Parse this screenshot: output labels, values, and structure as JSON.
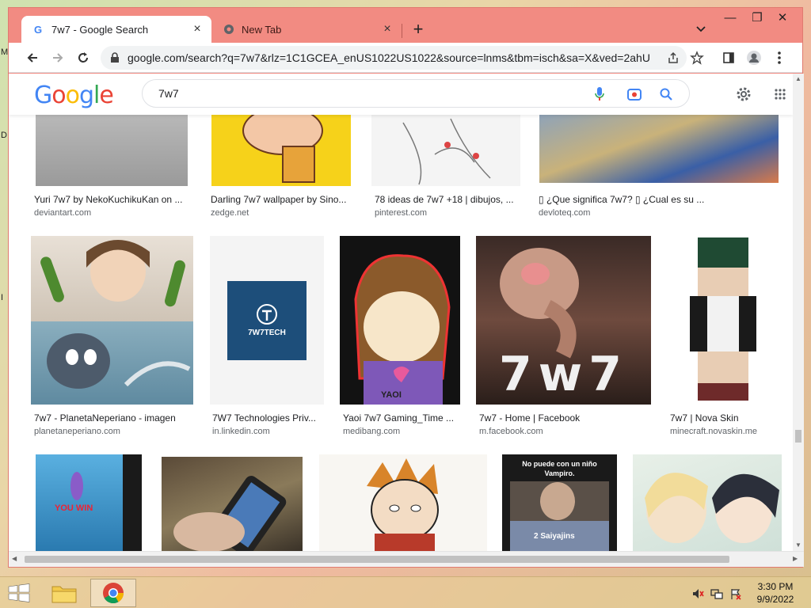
{
  "desktop": {
    "letters": [
      "M",
      "D",
      "I"
    ]
  },
  "browser": {
    "tabs": [
      {
        "title": "7w7 - Google Search",
        "active": true
      },
      {
        "title": "New Tab",
        "active": false
      }
    ],
    "new_tab_label": "+",
    "window_controls": {
      "minimize": "—",
      "restore": "❐",
      "close": "✕"
    },
    "url": "google.com/search?q=7w7&rlz=1C1GCEA_enUS1022US1022&source=lnms&tbm=isch&sa=X&ved=2ahU..."
  },
  "google": {
    "logo_letters": [
      {
        "ch": "G",
        "color": "#4285F4"
      },
      {
        "ch": "o",
        "color": "#EA4335"
      },
      {
        "ch": "o",
        "color": "#FBBC05"
      },
      {
        "ch": "g",
        "color": "#4285F4"
      },
      {
        "ch": "l",
        "color": "#34A853"
      },
      {
        "ch": "e",
        "color": "#EA4335"
      }
    ],
    "query": "7w7"
  },
  "results": {
    "row1": [
      {
        "caption": "Yuri 7w7 by NekoKuchikuKan on ...",
        "source": "deviantart.com"
      },
      {
        "caption": "Darling 7w7 wallpaper by Sino...",
        "source": "zedge.net"
      },
      {
        "caption": "78 ideas de 7w7 +18 | dibujos, ...",
        "source": "pinterest.com"
      },
      {
        "caption": "▯ ¿Que significa 7w7? ▯ ¿Cual es su ...",
        "source": "devloteq.com"
      }
    ],
    "row2": [
      {
        "caption": "7w7 - PlanetaNeperiano - imagen",
        "source": "planetaneperiano.com"
      },
      {
        "caption": "7W7 Technologies Priv...",
        "source": "in.linkedin.com"
      },
      {
        "caption": "Yaoi 7w7 Gaming_Time ...",
        "source": "medibang.com"
      },
      {
        "caption": "7w7 - Home | Facebook",
        "source": "m.facebook.com"
      },
      {
        "caption": "7w7 | Nova Skin",
        "source": "minecraft.novaskin.me"
      }
    ],
    "image_texts": {
      "logo_brand": "7W7TECH",
      "big_text": "7w7",
      "yaoi_shirt": "YAOI",
      "you_win": "YOU WIN",
      "meme_top": "No puede con un niño Vampiro.",
      "meme_bottom": "2 Saiyajins"
    }
  },
  "taskbar": {
    "time": "3:30 PM",
    "date": "9/9/2022"
  }
}
